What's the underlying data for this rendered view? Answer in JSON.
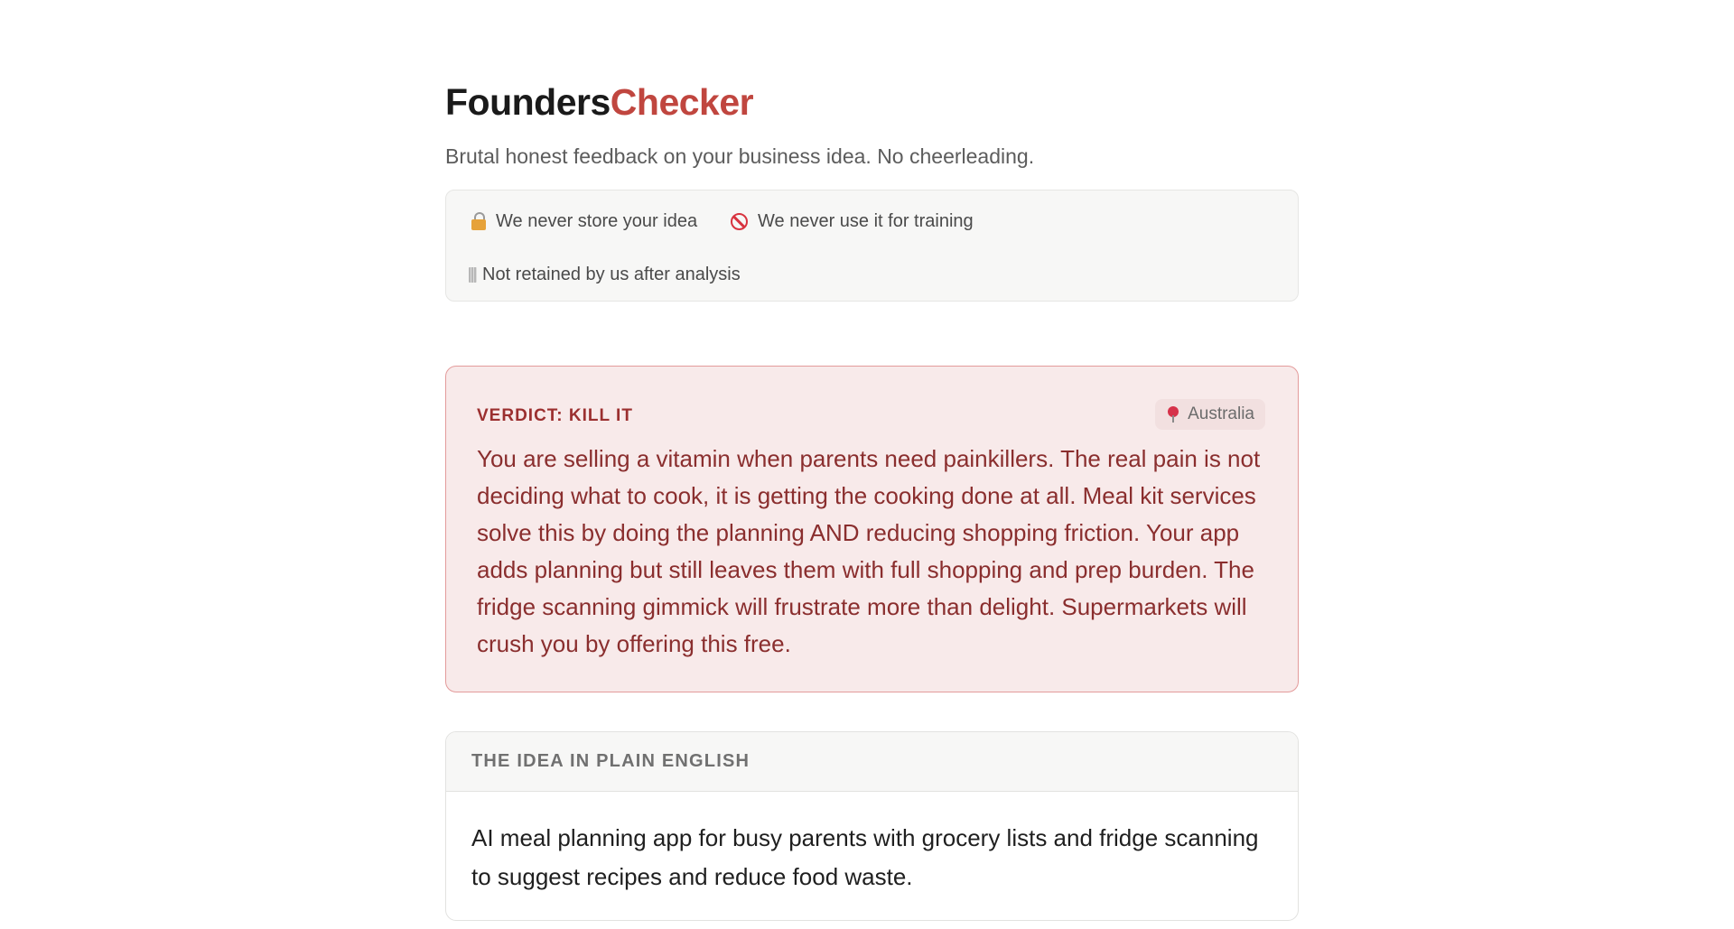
{
  "brand": {
    "name_part1": "Founders",
    "name_part2": "Checker",
    "accent_color": "#c0463f"
  },
  "tagline": "Brutal honest feedback on your business idea. No cheerleading.",
  "privacy": {
    "items": [
      {
        "icon": "lock-icon",
        "label": "We never store your idea"
      },
      {
        "icon": "no-entry-icon",
        "label": "We never use it for training"
      },
      {
        "icon": "trash-icon",
        "label": "Not retained by us after analysis"
      }
    ]
  },
  "verdict": {
    "title": "VERDICT: KILL IT",
    "location_icon": "pin-icon",
    "location": "Australia",
    "text": "You are selling a vitamin when parents need painkillers. The real pain is not deciding what to cook, it is getting the cooking done at all. Meal kit services solve this by doing the planning AND reducing shopping friction. Your app adds planning but still leaves them with full shopping and prep burden. The fridge scanning gimmick will frustrate more than delight. Supermarkets will crush you by offering this free.",
    "text_color": "#8a2e2e",
    "background_color": "#f8eaea",
    "border_color": "#e39b9b"
  },
  "idea": {
    "heading": "THE IDEA IN PLAIN ENGLISH",
    "text": "AI meal planning app for busy parents with grocery lists and fridge scanning to suggest recipes and reduce food waste."
  }
}
